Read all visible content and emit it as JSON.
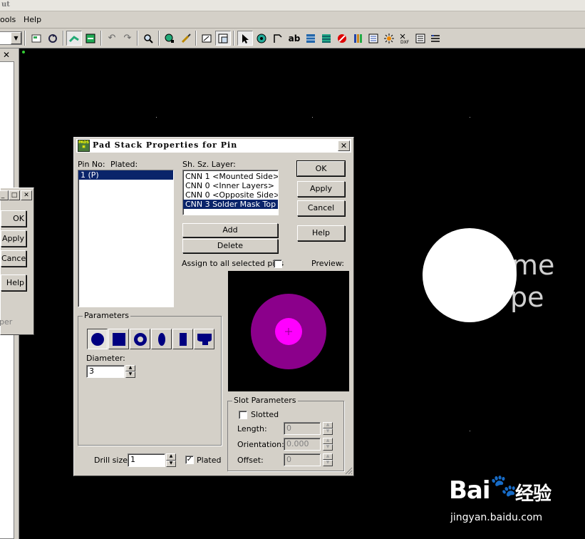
{
  "window": {
    "title_fragment": "ut"
  },
  "menu": [
    {
      "label": "ools"
    },
    {
      "label": "Help"
    }
  ],
  "dialog": {
    "title": "Pad Stack Properties for Pin",
    "pin_no_label": "Pin No:",
    "plated_label": "Plated:",
    "pins": [
      "1 (P)"
    ],
    "layers_label": "Sh. Sz. Layer:",
    "layers": [
      "CNN 1 <Mounted Side>",
      "CNN 0 <Inner Layers>",
      "CNN 0 <Opposite Side>",
      "CNN 3 Solder Mask Top"
    ],
    "buttons": {
      "ok": "OK",
      "apply": "Apply",
      "cancel": "Cancel",
      "help": "Help",
      "add": "Add",
      "delete": "Delete"
    },
    "assign_all_label": "Assign to all selected pins",
    "preview_label": "Preview:",
    "parameters": {
      "group_label": "Parameters",
      "diameter_label": "Diameter:",
      "diameter_value": "3"
    },
    "slot": {
      "group_label": "Slot Parameters",
      "slotted_label": "Slotted",
      "length_label": "Length:",
      "length_value": "0",
      "orientation_label": "Orientation:",
      "orientation_value": "0.000",
      "offset_label": "Offset:",
      "offset_value": "0"
    },
    "drill_label": "Drill size:",
    "drill_value": "1",
    "plated_checkbox_label": "Plated"
  },
  "side_dialog": {
    "buttons": [
      "OK",
      "Apply",
      "Cancel",
      "Help"
    ],
    "footer_fragment": "per"
  },
  "canvas_text": {
    "line1": "me",
    "line2": "pe"
  },
  "watermark": {
    "brand": "Bai",
    "brand_cn": "经验",
    "url": "jingyan.baidu.com"
  },
  "colors": {
    "selection": "#0a246a",
    "preview_outer": "#8b008b",
    "preview_inner": "#ff00ff",
    "shape_fill": "#000080"
  },
  "icons": [
    "layers-props-icon",
    "redraw-icon",
    "route-icon",
    "select-mode-icon",
    "undo-icon",
    "redo-icon",
    "zoom-icon",
    "query-icon",
    "brush-icon",
    "open-icon",
    "window-icon",
    "pointer-icon",
    "rotate-icon",
    "move-text-icon",
    "ab-text-icon",
    "hatch-icon",
    "layer-stack-icon",
    "no-entry-icon",
    "book-icon",
    "bom-icon",
    "sun-icon",
    "dxf-icon",
    "list-icon",
    "grid-icon"
  ]
}
